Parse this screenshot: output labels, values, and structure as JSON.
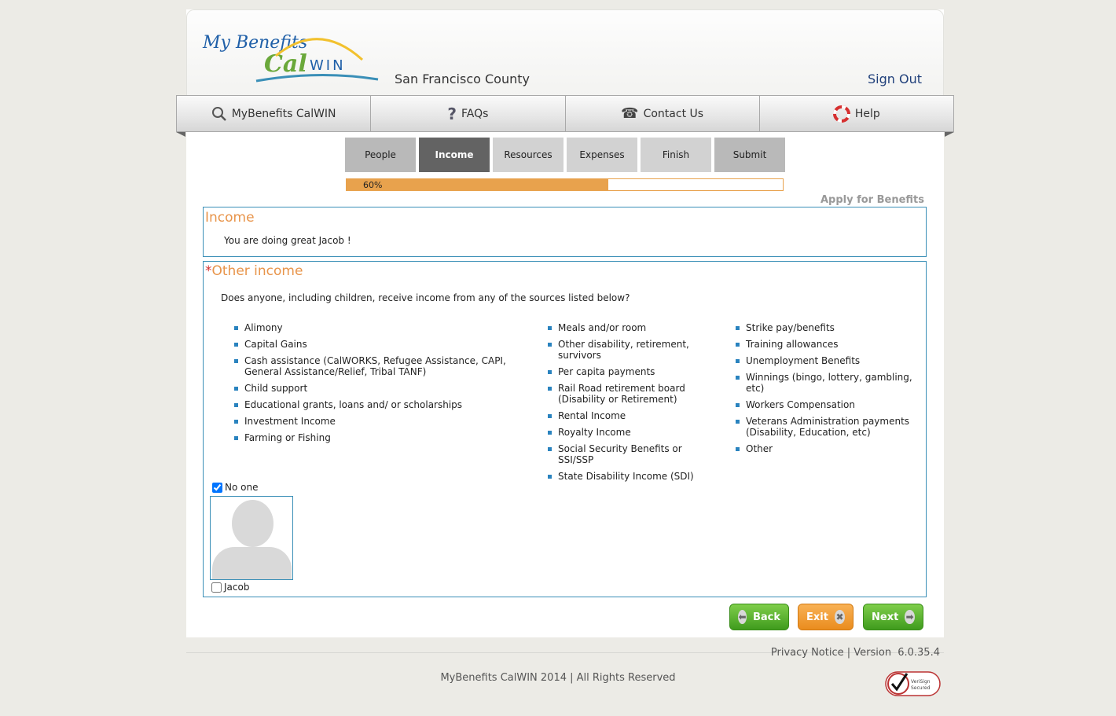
{
  "header": {
    "logo_text": "MyBenefits CalWIN",
    "county": "San Francisco County",
    "sign_out": "Sign Out"
  },
  "nav": [
    {
      "label": "MyBenefits CalWIN",
      "icon": "search-icon"
    },
    {
      "label": "FAQs",
      "icon": "question-icon"
    },
    {
      "label": "Contact Us",
      "icon": "phone-icon"
    },
    {
      "label": "Help",
      "icon": "lifebuoy-icon"
    }
  ],
  "steps": [
    {
      "label": "People"
    },
    {
      "label": "Income",
      "active": true
    },
    {
      "label": "Resources"
    },
    {
      "label": "Expenses"
    },
    {
      "label": "Finish"
    },
    {
      "label": "Submit"
    }
  ],
  "progress": {
    "label": "60%",
    "value": 0.6
  },
  "apply_label": "Apply for Benefits",
  "income_section": {
    "title": "Income",
    "greeting": "You are doing great Jacob !"
  },
  "other_income": {
    "required_mark": "*",
    "title": "Other income",
    "question": "Does anyone, including children, receive income from any of the sources listed below?",
    "col1": [
      "Alimony",
      "Capital Gains",
      "Cash assistance (CalWORKS, Refugee Assistance, CAPI, General Assistance/Relief, Tribal TANF)",
      "Child support",
      "Educational grants, loans and/ or scholarships",
      "Investment Income",
      "Farming or Fishing"
    ],
    "col2": [
      "Meals and/or room",
      "Other disability, retirement, survivors",
      "Per capita payments",
      "Rail Road retirement board (Disability or Retirement)",
      "Rental Income",
      "Royalty Income",
      "Social Security Benefits or SSI/SSP",
      "State Disability Income (SDI)"
    ],
    "col3": [
      "Strike pay/benefits",
      "Training allowances",
      "Unemployment Benefits",
      "Winnings (bingo, lottery, gambling, etc)",
      "Workers Compensation",
      "Veterans Administration payments (Disability, Education, etc)",
      "Other"
    ],
    "no_one_label": "No one",
    "no_one_checked": true,
    "person_label": "Jacob",
    "person_checked": false
  },
  "buttons": {
    "back": "Back",
    "exit": "Exit",
    "next": "Next"
  },
  "footer": {
    "privacy": "Privacy Notice",
    "separator": "|",
    "version_label": "Version",
    "version": "6.0.35.4",
    "copyright": "MyBenefits CalWIN 2014 | All Rights Reserved",
    "seal_text": "VeriSign Secured"
  },
  "colors": {
    "accent_orange": "#e8944a",
    "border_blue": "#3a8fb7",
    "bullet_blue": "#2a83bf"
  }
}
